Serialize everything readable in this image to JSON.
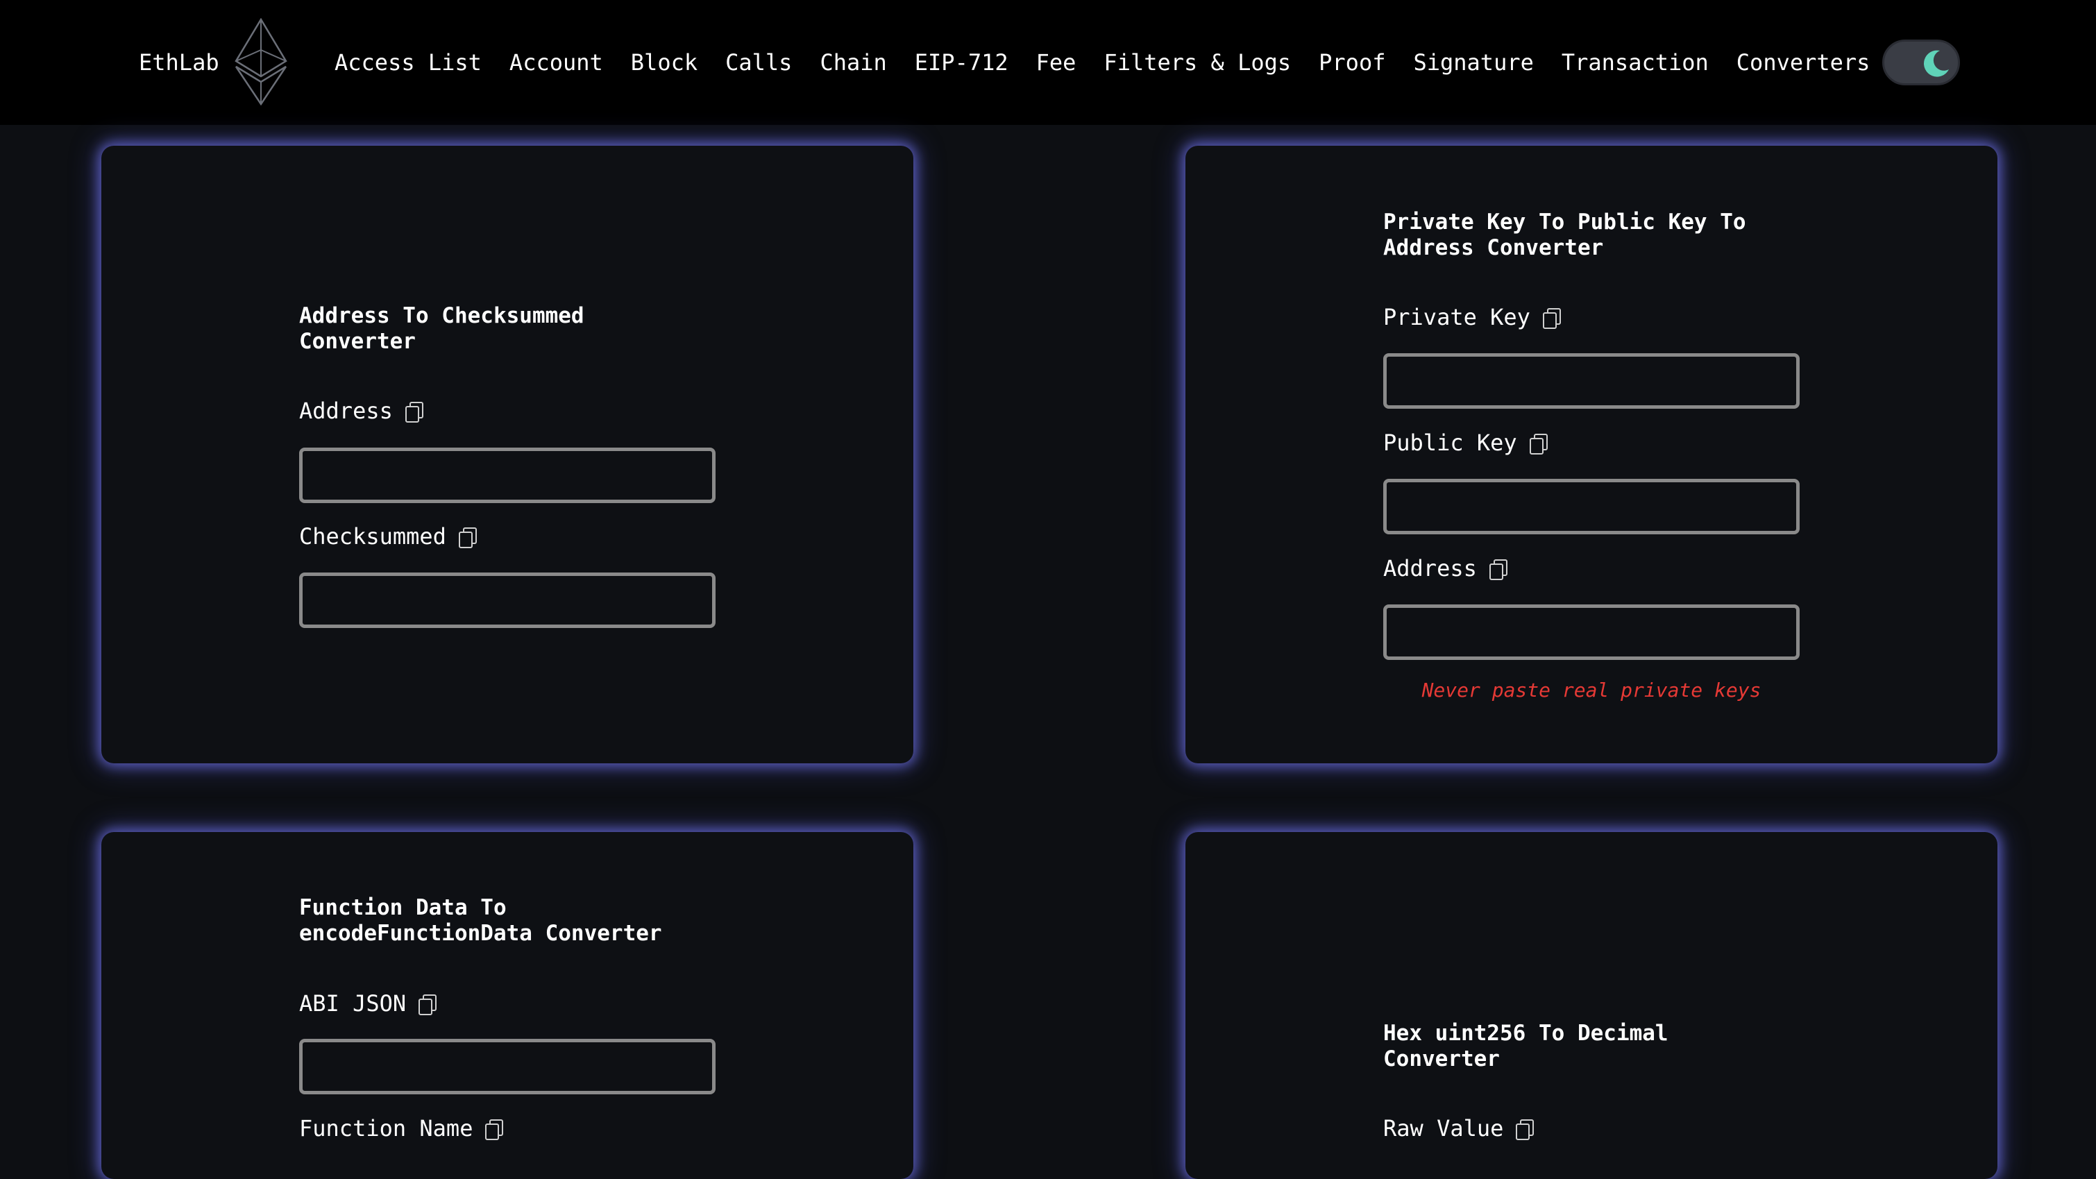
{
  "header": {
    "brand": "EthLab",
    "logo_icon": "ethereum-diamond-icon",
    "nav": [
      "Access List",
      "Account",
      "Block",
      "Calls",
      "Chain",
      "EIP-712",
      "Fee",
      "Filters & Logs",
      "Proof",
      "Signature",
      "Transaction",
      "Converters"
    ],
    "theme_toggle_icon": "moon-icon",
    "theme_mode": "dark"
  },
  "cards": {
    "checksum": {
      "title": "Address To Checksummed Converter",
      "fields": [
        {
          "label": "Address",
          "value": ""
        },
        {
          "label": "Checksummed",
          "value": ""
        }
      ]
    },
    "private_key": {
      "title": "Private Key To Public Key To Address Converter",
      "fields": [
        {
          "label": "Private Key",
          "value": ""
        },
        {
          "label": "Public Key",
          "value": ""
        },
        {
          "label": "Address",
          "value": ""
        }
      ],
      "warning": "Never paste real private keys"
    },
    "function_data": {
      "title": "Function Data To encodeFunctionData Converter",
      "fields": [
        {
          "label": "ABI JSON",
          "value": ""
        },
        {
          "label": "Function Name",
          "value": ""
        }
      ]
    },
    "hex_uint": {
      "title": "Hex uint256 To Decimal Converter",
      "fields": [
        {
          "label": "Raw Value",
          "value": ""
        }
      ]
    }
  },
  "colors": {
    "background": "#0d0f13",
    "header": "#000000",
    "card": "#0e1014",
    "card_glow": "#6e70e6",
    "input_border": "#8a8a8a",
    "warning": "#e53935",
    "toggle_moon": "#5fd3b8"
  }
}
